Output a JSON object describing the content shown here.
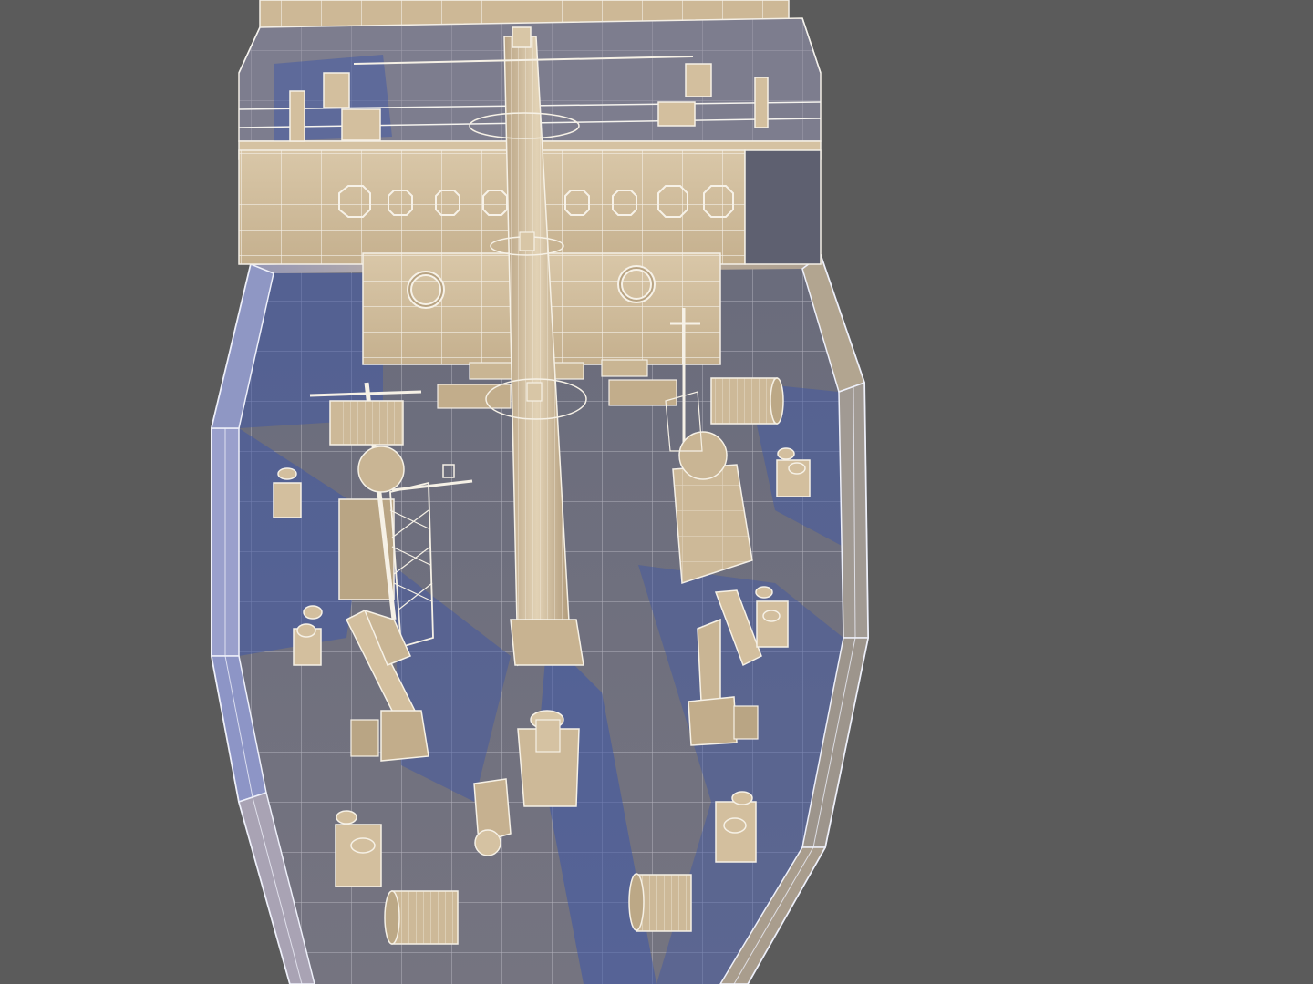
{
  "scene": {
    "subject": "3d-ship-bow-wireframe-render",
    "colors": {
      "background": "#5b5b5b",
      "hull_light": "#d8c4a2",
      "hull_shadow": "#4e5f9a",
      "deck": "#6d6f80",
      "deck_shadow": "#3f57a6",
      "wire": "#f2efe8"
    },
    "elements": [
      "superstructure",
      "bridge-deck-railing",
      "forecastle-wall",
      "central-mast",
      "cargo-crane-port",
      "cargo-crane-starboard",
      "deck-cranes",
      "bollards",
      "mooring-winches",
      "anchor-windlass",
      "hatch-cover"
    ]
  }
}
